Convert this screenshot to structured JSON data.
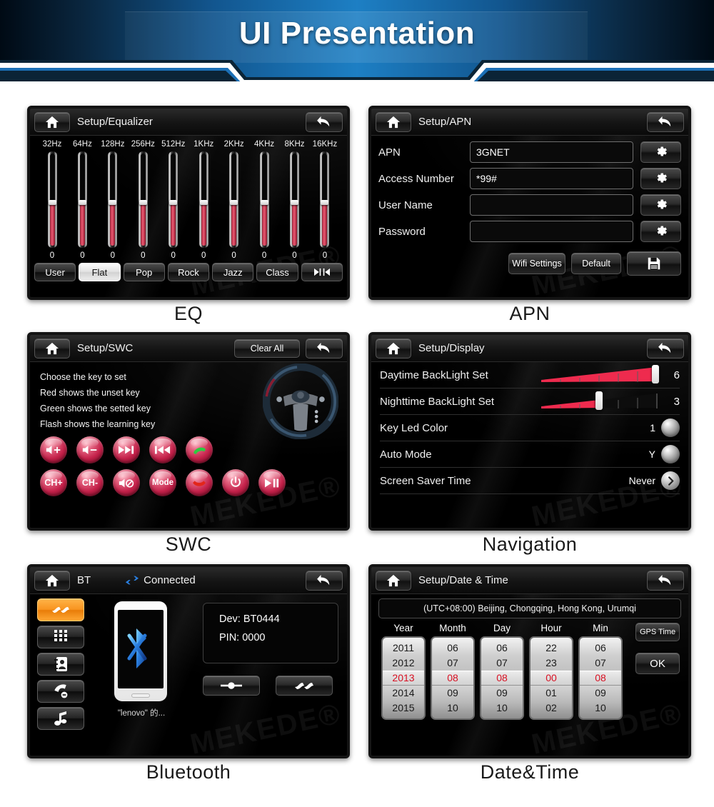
{
  "header": {
    "title": "UI Presentation"
  },
  "panels": {
    "eq": {
      "caption": "EQ",
      "titlebar": {
        "home_icon": "home-icon",
        "title": "Setup/Equalizer",
        "back_icon": "back-arrow-icon"
      },
      "bands": [
        {
          "label": "32Hz",
          "value": "0"
        },
        {
          "label": "64Hz",
          "value": "0"
        },
        {
          "label": "128Hz",
          "value": "0"
        },
        {
          "label": "256Hz",
          "value": "0"
        },
        {
          "label": "512Hz",
          "value": "0"
        },
        {
          "label": "1KHz",
          "value": "0"
        },
        {
          "label": "2KHz",
          "value": "0"
        },
        {
          "label": "4KHz",
          "value": "0"
        },
        {
          "label": "8KHz",
          "value": "0"
        },
        {
          "label": "16KHz",
          "value": "0"
        }
      ],
      "presets": [
        {
          "label": "User",
          "active": false
        },
        {
          "label": "Flat",
          "active": true
        },
        {
          "label": "Pop",
          "active": false
        },
        {
          "label": "Rock",
          "active": false
        },
        {
          "label": "Jazz",
          "active": false
        },
        {
          "label": "Class",
          "active": false
        }
      ],
      "next_preset_icon": "skip-next-icon"
    },
    "apn": {
      "caption": "APN",
      "titlebar": {
        "home_icon": "home-icon",
        "title": "Setup/APN",
        "back_icon": "back-arrow-icon"
      },
      "fields": [
        {
          "label": "APN",
          "value": "3GNET",
          "gear_icon": "gear-icon"
        },
        {
          "label": "Access Number",
          "value": "*99#",
          "gear_icon": "gear-icon"
        },
        {
          "label": "User Name",
          "value": "",
          "gear_icon": "gear-icon"
        },
        {
          "label": "Password",
          "value": "",
          "gear_icon": "gear-icon"
        }
      ],
      "actions": {
        "wifi": "Wifi Settings",
        "default": "Default",
        "save_icon": "save-floppy-icon"
      }
    },
    "swc": {
      "caption": "SWC",
      "titlebar": {
        "home_icon": "home-icon",
        "title": "Setup/SWC",
        "clear_all": "Clear All",
        "back_icon": "back-arrow-icon"
      },
      "instructions": [
        "Choose the key to set",
        "Red shows the unset key",
        "Green shows the setted key",
        "Flash shows the learning key"
      ],
      "keys_row1": [
        {
          "label": "",
          "icon": "volume-up-icon"
        },
        {
          "label": "",
          "icon": "volume-down-icon"
        },
        {
          "label": "",
          "icon": "next-track-icon"
        },
        {
          "label": "",
          "icon": "prev-track-icon"
        },
        {
          "label": "",
          "icon": "call-answer-icon"
        }
      ],
      "keys_row2": [
        {
          "label": "CH+",
          "icon": ""
        },
        {
          "label": "CH-",
          "icon": ""
        },
        {
          "label": "",
          "icon": "mute-icon"
        },
        {
          "label": "Mode",
          "icon": ""
        },
        {
          "label": "",
          "icon": "call-end-icon"
        },
        {
          "label": "",
          "icon": "power-icon"
        },
        {
          "label": "",
          "icon": "play-pause-icon"
        }
      ],
      "wheel_icon": "steering-wheel-icon"
    },
    "display": {
      "caption": "Navigation",
      "titlebar": {
        "home_icon": "home-icon",
        "title": "Setup/Display",
        "back_icon": "back-arrow-icon"
      },
      "rows": [
        {
          "label": "Daytime BackLight Set",
          "type": "slider",
          "value": "6",
          "max": 6
        },
        {
          "label": "Nighttime BackLight Set",
          "type": "slider",
          "value": "3",
          "max": 6
        },
        {
          "label": "Key Led Color",
          "type": "dial",
          "value": "1"
        },
        {
          "label": "Auto Mode",
          "type": "dial",
          "value": "Y"
        },
        {
          "label": "Screen Saver Time",
          "type": "chevron",
          "value": "Never"
        }
      ]
    },
    "bt": {
      "caption": "Bluetooth",
      "titlebar": {
        "home_icon": "home-icon",
        "title": "BT",
        "status_icon": "bt-link-icon",
        "status": "Connected",
        "back_icon": "back-arrow-icon"
      },
      "tabs": [
        {
          "icon": "pair-link-icon",
          "active": true
        },
        {
          "icon": "dialpad-icon",
          "active": false
        },
        {
          "icon": "contacts-icon",
          "active": false
        },
        {
          "icon": "call-log-icon",
          "active": false
        },
        {
          "icon": "music-note-icon",
          "active": false
        }
      ],
      "phone_icon": "bluetooth-logo-icon",
      "phone_caption": "\"lenovo\" 的...",
      "info": {
        "device": "Dev: BT0444",
        "pin": "PIN: 0000"
      },
      "actions": [
        {
          "icon": "disconnect-icon"
        },
        {
          "icon": "pair-link-icon"
        }
      ]
    },
    "datetime": {
      "caption": "Date&Time",
      "titlebar": {
        "home_icon": "home-icon",
        "title": "Setup/Date & Time",
        "back_icon": "back-arrow-icon"
      },
      "timezone": "(UTC+08:00) Beijing, Chongqing, Hong Kong, Urumqi",
      "columns": [
        {
          "header": "Year",
          "items": [
            "2011",
            "2012",
            "2013",
            "2014",
            "2015"
          ],
          "selected_index": 2
        },
        {
          "header": "Month",
          "items": [
            "06",
            "07",
            "08",
            "09",
            "10"
          ],
          "selected_index": 2
        },
        {
          "header": "Day",
          "items": [
            "06",
            "07",
            "08",
            "09",
            "10"
          ],
          "selected_index": 2
        },
        {
          "header": "Hour",
          "items": [
            "22",
            "23",
            "00",
            "01",
            "02"
          ],
          "selected_index": 2
        },
        {
          "header": "Min",
          "items": [
            "06",
            "07",
            "08",
            "09",
            "10"
          ],
          "selected_index": 2
        }
      ],
      "buttons": {
        "gps_time": "GPS Time",
        "ok": "OK"
      }
    }
  },
  "watermark": "MEKEDE®",
  "colors": {
    "header_blue": "#1d7fc4",
    "accent_red": "#d94a63",
    "accent_orange": "#f89420",
    "selected_red": "#d81022",
    "bt_blue": "#2a7fe0"
  }
}
